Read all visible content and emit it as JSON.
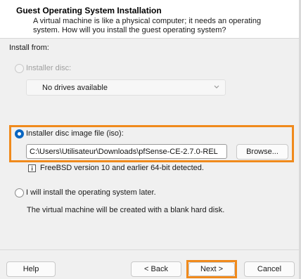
{
  "header": {
    "title": "Guest Operating System Installation",
    "description": "A virtual machine is like a physical computer; it needs an operating system. How will you install the guest operating system?"
  },
  "install_from_label": "Install from:",
  "options": {
    "installer_disc": {
      "label": "Installer disc:",
      "selected": false,
      "enabled": false,
      "dropdown_value": "No drives available"
    },
    "iso": {
      "label": "Installer disc image file (iso):",
      "selected": true,
      "path_value": "C:\\Users\\Utilisateur\\Downloads\\pfSense-CE-2.7.0-REL",
      "browse_label": "Browse...",
      "detection_text": "FreeBSD version 10 and earlier 64-bit detected."
    },
    "later": {
      "label": "I will install the operating system later.",
      "selected": false,
      "description": "The virtual machine will be created with a blank hard disk."
    }
  },
  "buttons": {
    "help": "Help",
    "back": "< Back",
    "next": "Next >",
    "cancel": "Cancel"
  },
  "colors": {
    "highlight": "#f08a1c",
    "radio_selected": "#0a66c2"
  },
  "icons": {
    "info": "info-icon",
    "dropdown": "chevron-down-icon"
  }
}
